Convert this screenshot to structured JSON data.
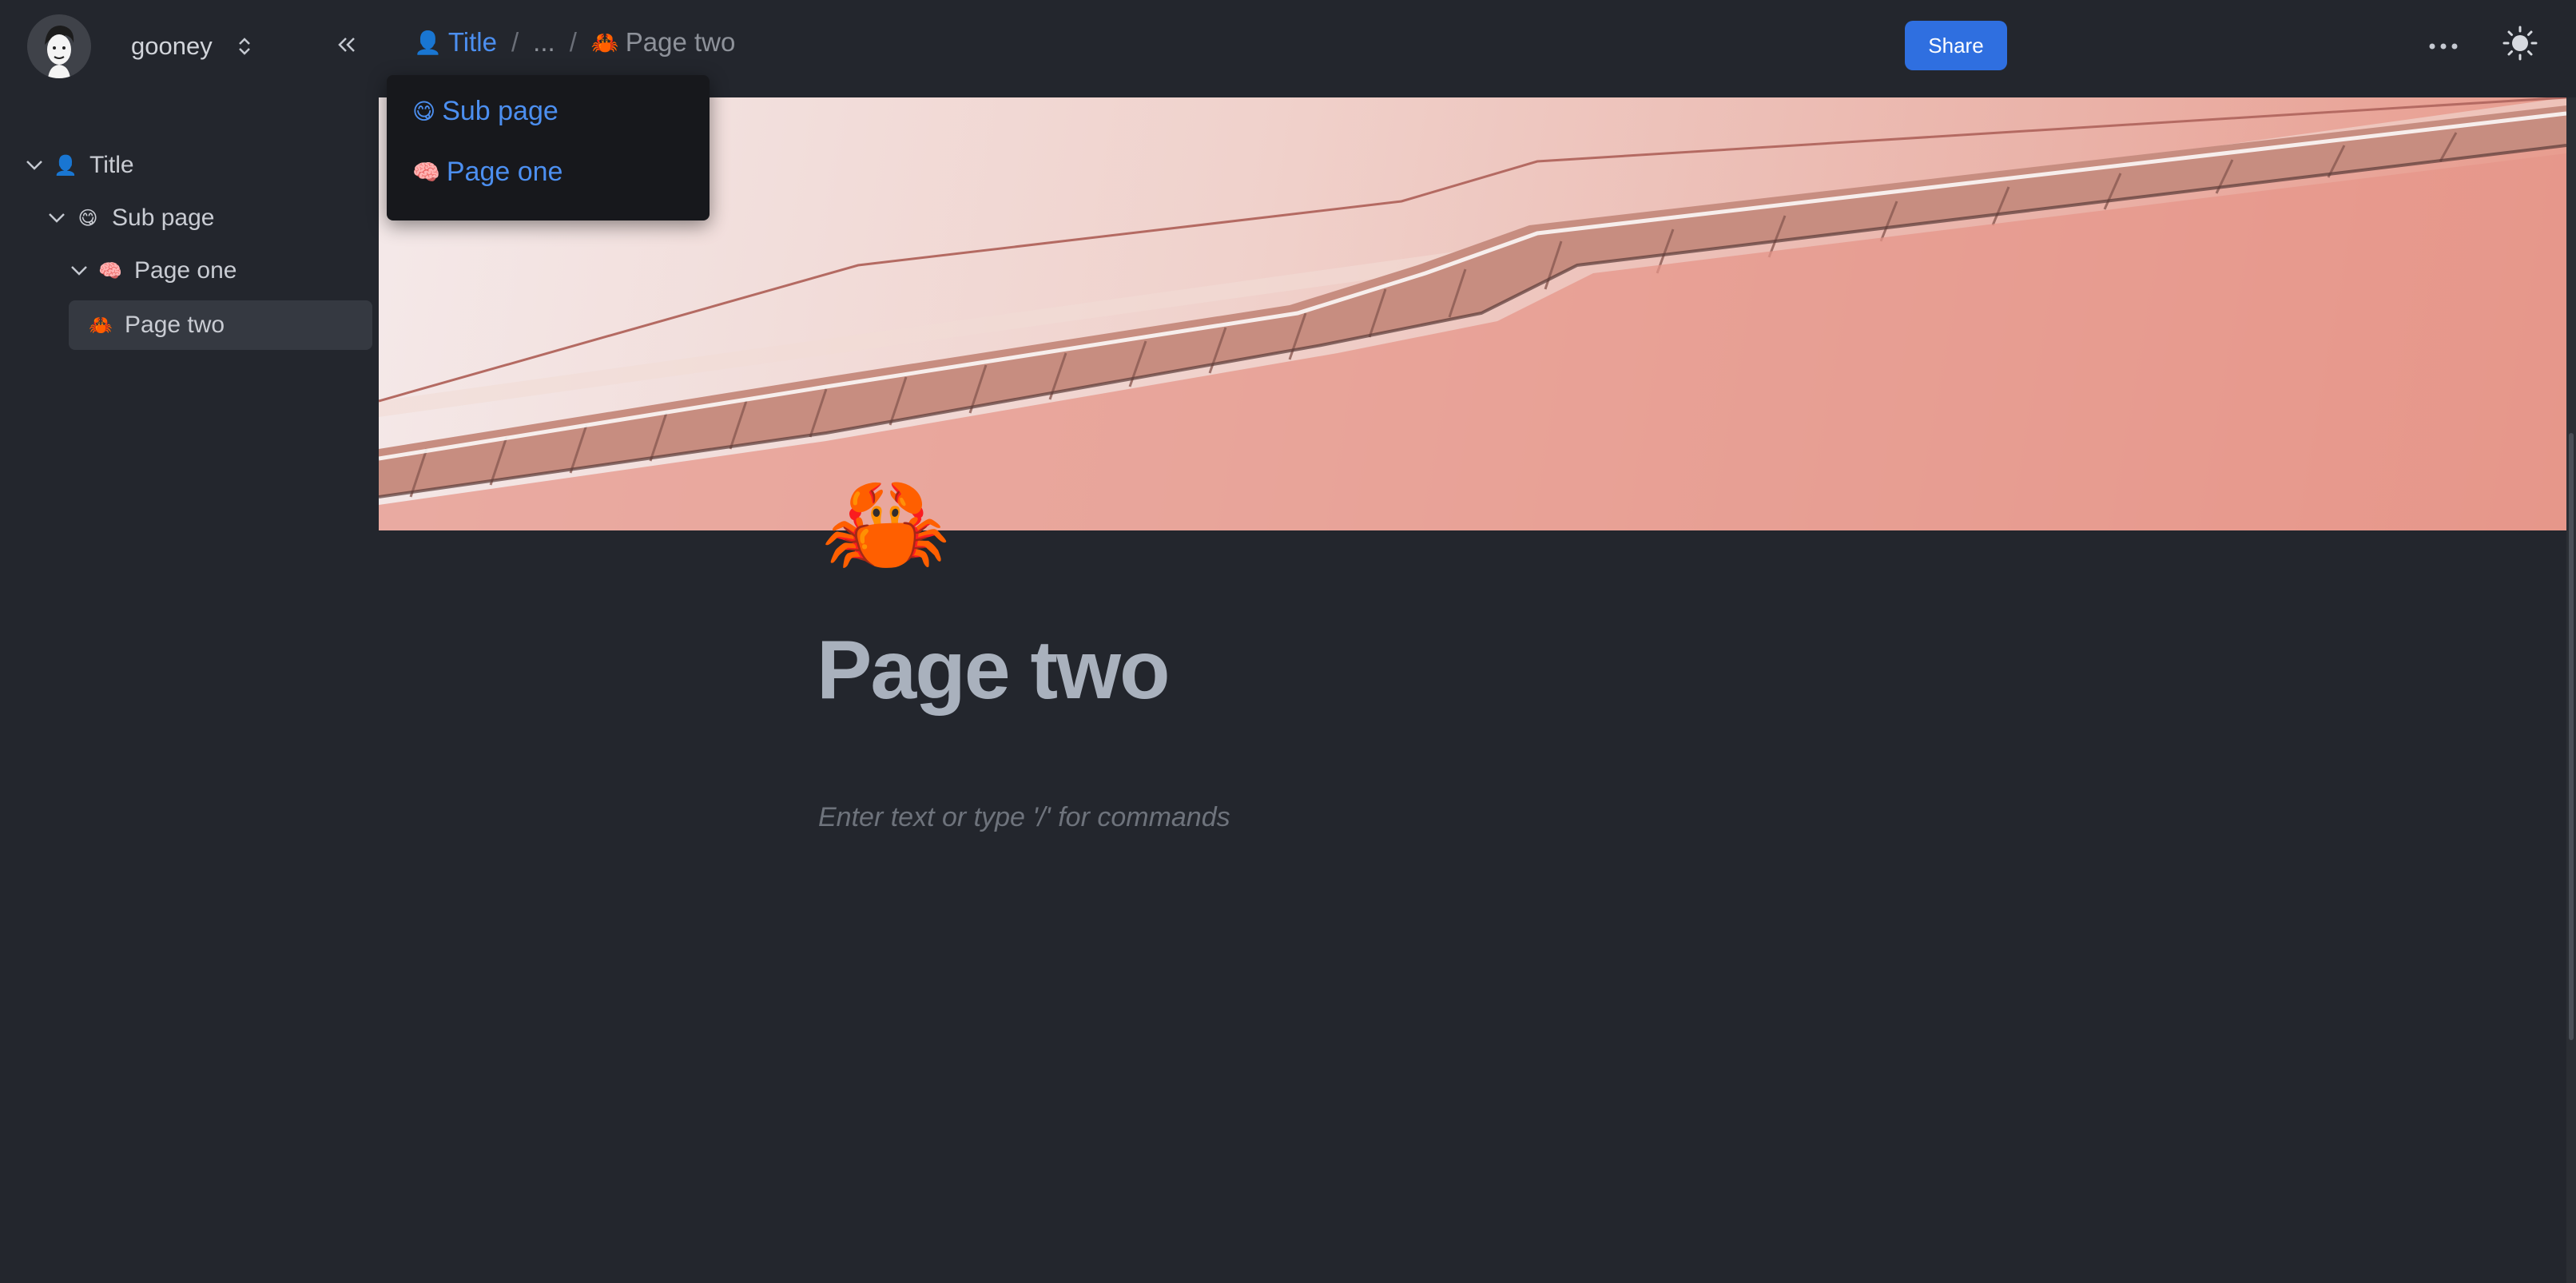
{
  "workspace": {
    "name": "gooney"
  },
  "sidebar": {
    "items": [
      {
        "label": "Title",
        "emoji": "👤"
      },
      {
        "label": "Sub page",
        "emoji": "😋"
      },
      {
        "label": "Page one",
        "emoji": "🧠"
      },
      {
        "label": "Page two",
        "emoji": "🦀"
      }
    ]
  },
  "breadcrumb": {
    "root_label": "Title",
    "root_emoji": "👤",
    "separator": "/",
    "ellipsis": "...",
    "current_label": "Page two",
    "current_emoji": "🦀"
  },
  "breadcrumb_dropdown": {
    "items": [
      {
        "label": "Sub page",
        "emoji": "😋"
      },
      {
        "label": "Page one",
        "emoji": "🧠"
      }
    ]
  },
  "toolbar": {
    "share_label": "Share"
  },
  "page": {
    "icon": "🦀",
    "title": "Page two",
    "placeholder": "Enter text or type '/' for commands"
  },
  "colors": {
    "background": "#23262d",
    "accent": "#2f6fe0",
    "link": "#4c8ff0",
    "dropdown": "#17181c"
  },
  "icons": {
    "collapse": "chevrons-left-icon",
    "switch": "chevron-up-down-icon",
    "more": "ellipsis-icon",
    "theme": "sun-icon"
  }
}
